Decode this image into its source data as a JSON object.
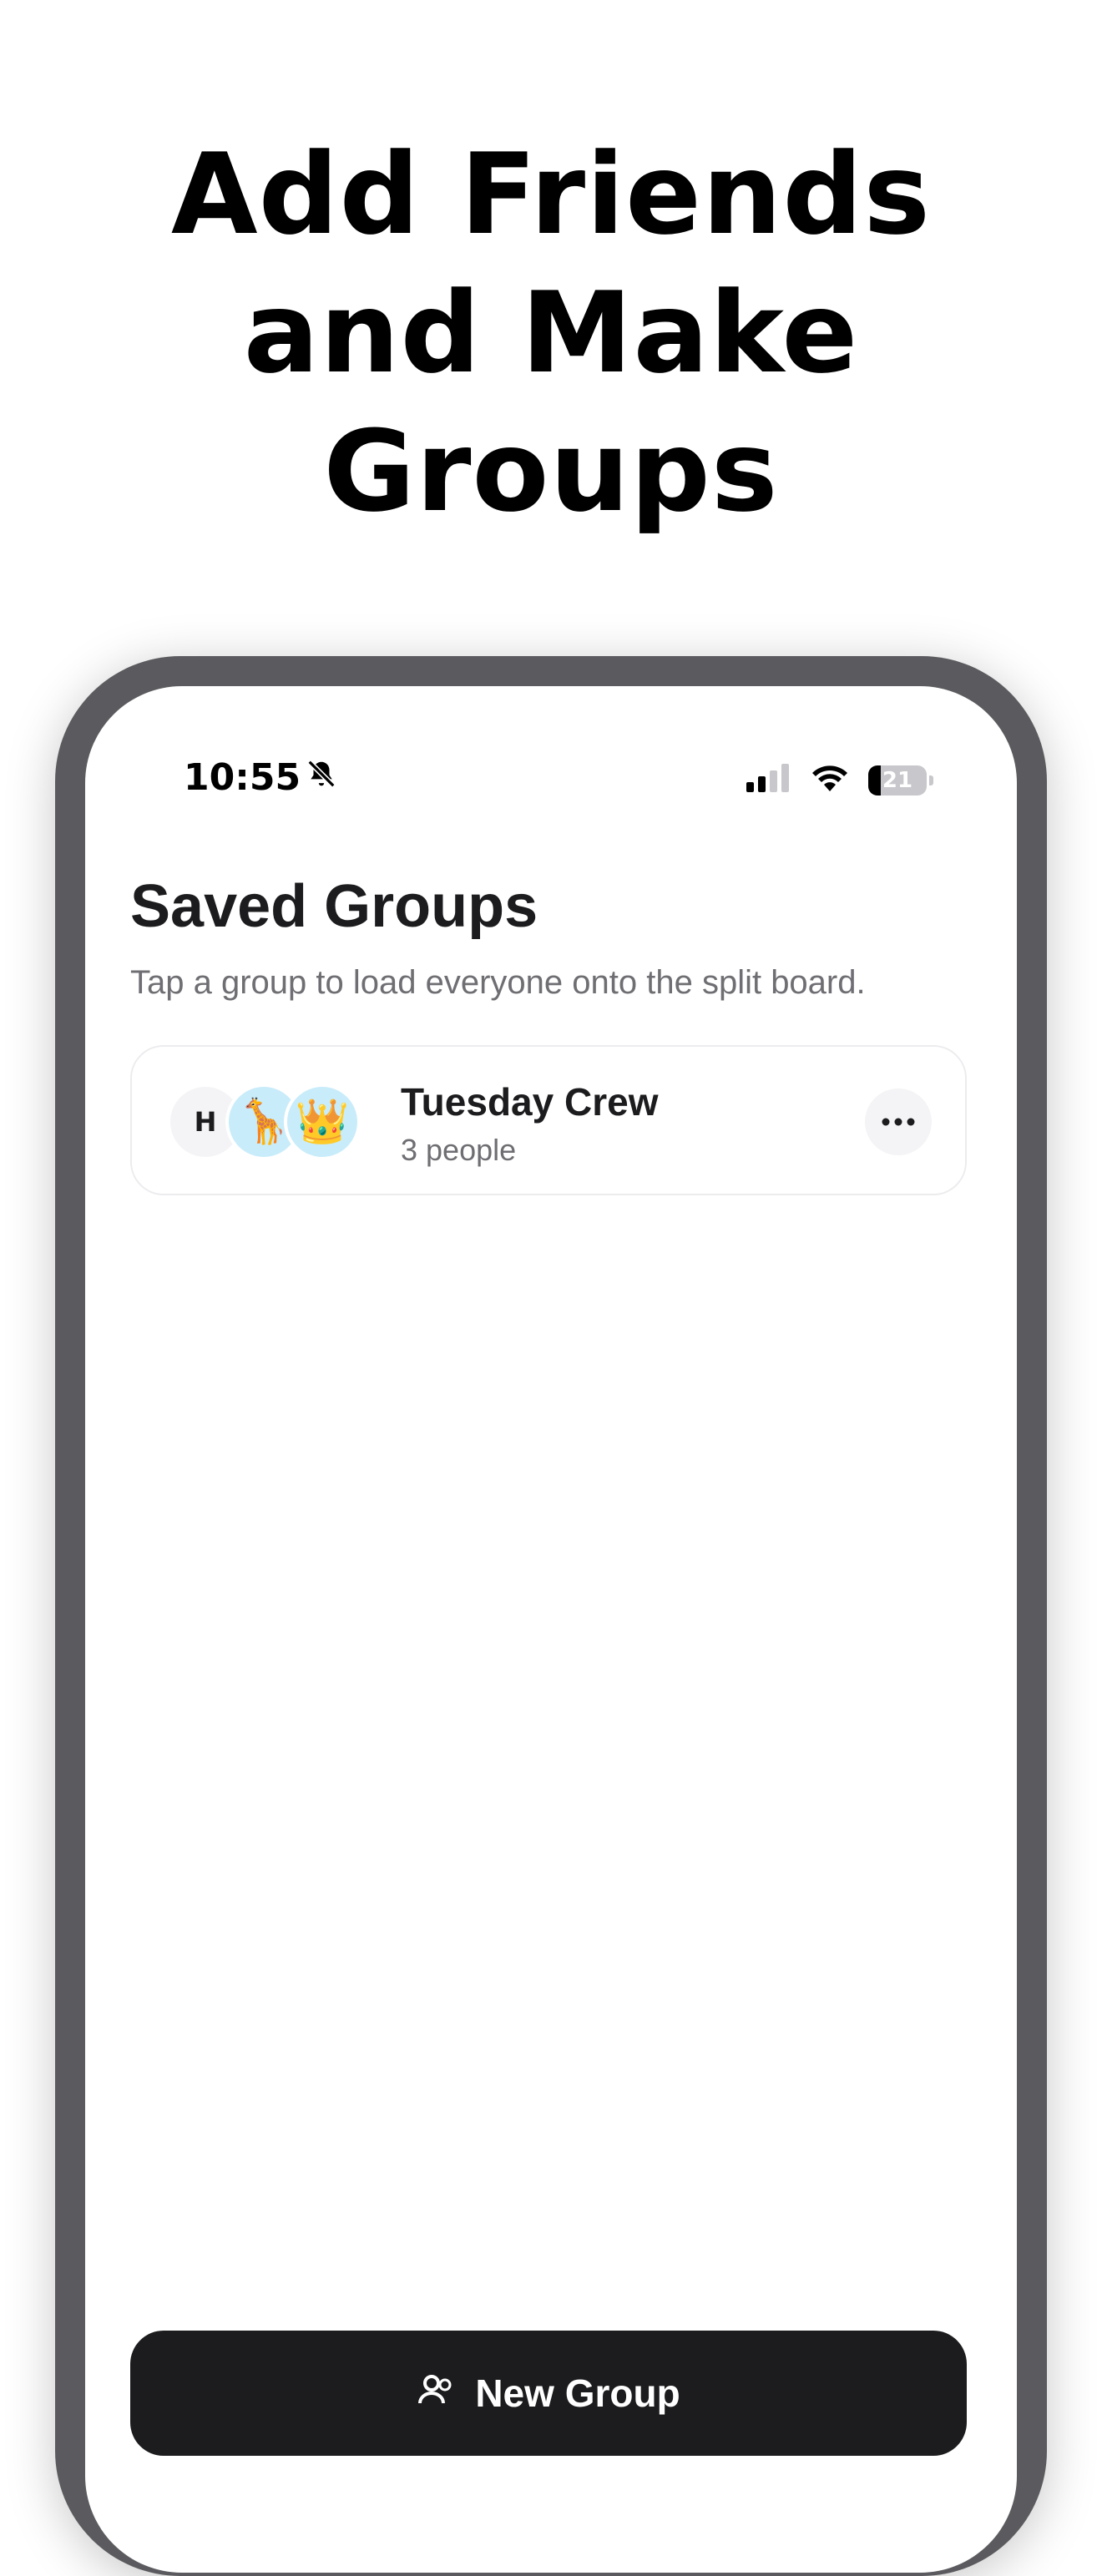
{
  "headline": {
    "line1": "Add Friends",
    "line2": "and Make",
    "line3": "Groups"
  },
  "status_bar": {
    "time": "10:55",
    "battery_percent": "21",
    "battery_level": 0.21,
    "icons": [
      "bell-slash-icon",
      "cellular-signal-icon",
      "wifi-icon",
      "battery-icon"
    ]
  },
  "screen": {
    "title": "Saved Groups",
    "subtitle": "Tap a group to load everyone onto the split board."
  },
  "groups": [
    {
      "name": "Tuesday Crew",
      "member_count": "3 people",
      "avatars": [
        {
          "type": "initial",
          "value": "H"
        },
        {
          "type": "emoji",
          "value": "🦒"
        },
        {
          "type": "emoji",
          "value": "👑"
        }
      ]
    }
  ],
  "footer_button": {
    "label": "New Group",
    "icon": "people-icon"
  },
  "colors": {
    "accent_dark": "#1c1c1e",
    "frame": "#5b5a5e",
    "secondary_text": "#6e6e73",
    "avatar_bg": "#c9ecfa"
  }
}
